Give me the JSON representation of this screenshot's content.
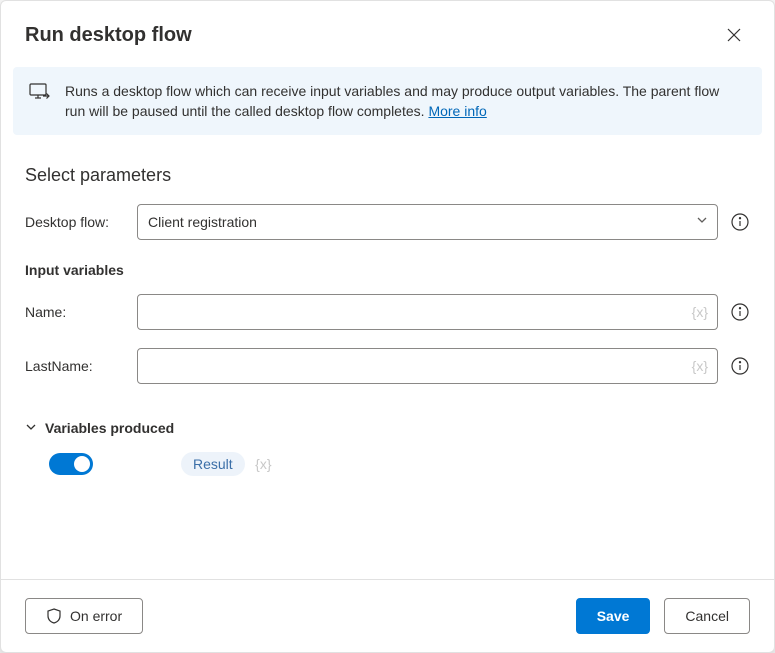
{
  "dialog": {
    "title": "Run desktop flow"
  },
  "banner": {
    "text": "Runs a desktop flow which can receive input variables and may produce output variables. The parent flow run will be paused until the called desktop flow completes. ",
    "link_text": "More info"
  },
  "parameters": {
    "section_title": "Select parameters",
    "desktop_flow_label": "Desktop flow:",
    "desktop_flow_value": "Client registration",
    "input_vars_title": "Input variables",
    "inputs": {
      "name_label": "Name:",
      "name_value": "",
      "lastname_label": "LastName:",
      "lastname_value": ""
    },
    "var_placeholder": "{x}"
  },
  "produced": {
    "title": "Variables produced",
    "result_label": "Result",
    "var_placeholder": "{x}"
  },
  "footer": {
    "on_error": "On error",
    "save": "Save",
    "cancel": "Cancel"
  }
}
